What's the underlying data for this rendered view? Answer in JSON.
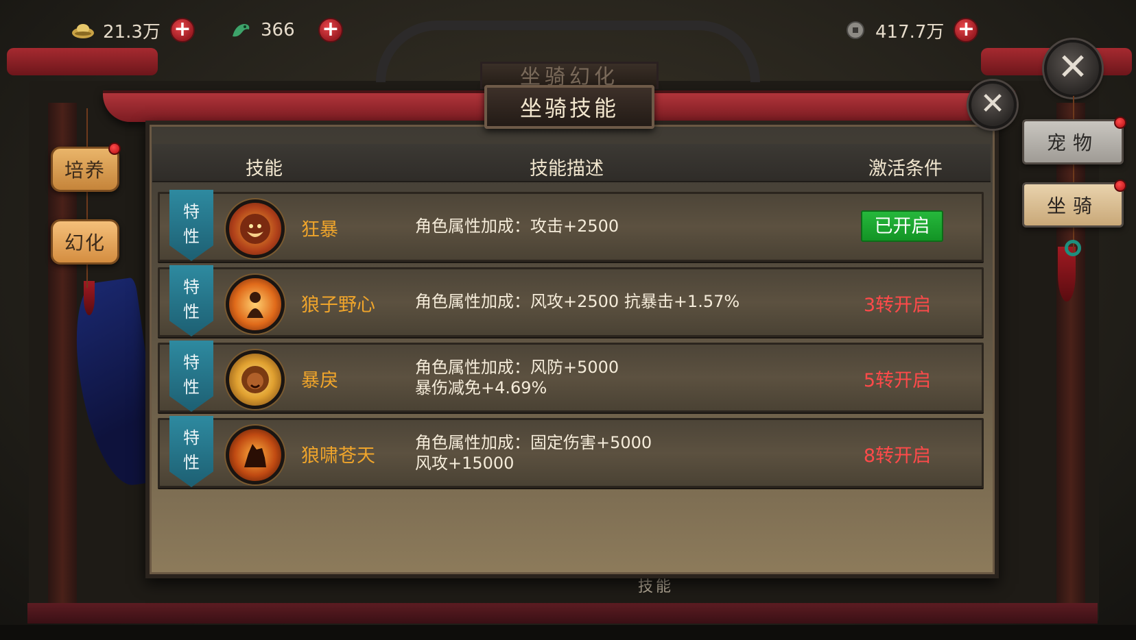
{
  "resources": [
    {
      "icon": "gold-ingot-icon",
      "value": "21.3万"
    },
    {
      "icon": "jade-bird-icon",
      "value": "366"
    },
    {
      "icon": "copper-coin-icon",
      "value": "417.7万"
    }
  ],
  "background": {
    "subtitle": "坐骑幻化",
    "under_label": "技能"
  },
  "dialog": {
    "title": "坐骑技能",
    "headers": {
      "skill": "技能",
      "description": "技能描述",
      "condition": "激活条件"
    }
  },
  "left_tabs": [
    {
      "label": "培养",
      "has_red_dot": true
    },
    {
      "label": "幻化",
      "has_red_dot": false
    }
  ],
  "right_tabs": [
    {
      "label": "宠物",
      "has_red_dot": true
    },
    {
      "label": "坐骑",
      "has_red_dot": true
    }
  ],
  "skills": [
    {
      "tag_lines": [
        "特",
        "性"
      ],
      "name": "狂暴",
      "icon": "roaring-lion-icon",
      "desc_lines": [
        "角色属性加成：攻击+2500"
      ],
      "condition": "已开启",
      "activated": true
    },
    {
      "tag_lines": [
        "特",
        "性"
      ],
      "name": "狼子野心",
      "icon": "flaming-warrior-icon",
      "desc_lines": [
        "角色属性加成：风攻+2500 抗暴击+1.57%"
      ],
      "condition": "3转开启",
      "activated": false
    },
    {
      "tag_lines": [
        "特",
        "性"
      ],
      "name": "暴戾",
      "icon": "fierce-lion-icon",
      "desc_lines": [
        "角色属性加成：风防+5000",
        "暴伤减免+4.69%"
      ],
      "condition": "5转开启",
      "activated": false
    },
    {
      "tag_lines": [
        "特",
        "性"
      ],
      "name": "狼啸苍天",
      "icon": "howling-wolf-icon",
      "desc_lines": [
        "角色属性加成：固定伤害+5000",
        "风攻+15000"
      ],
      "condition": "8转开启",
      "activated": false
    }
  ],
  "colors": {
    "skill_name": "#f0a52b",
    "locked_condition": "#ff4a4a",
    "activated_bg": "#1ea532",
    "ribbon": "#2a7f94"
  }
}
